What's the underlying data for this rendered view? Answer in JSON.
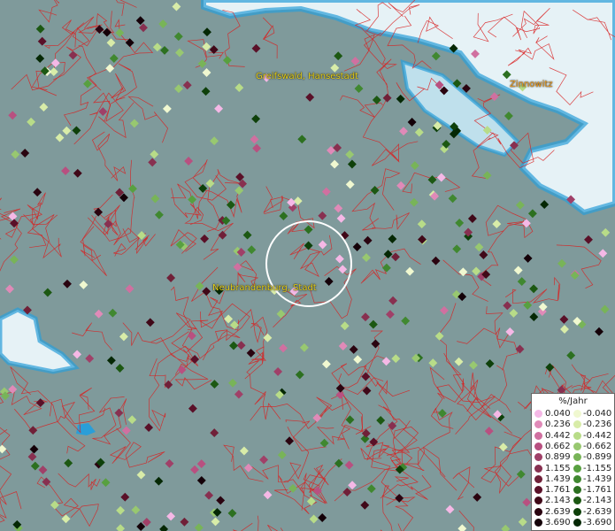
{
  "places": {
    "greifswald": "Greifswald, Hansestadt",
    "zinnowitz": "Zinnowitz",
    "neubrandenburg": "Neubrandenburg, Stadt"
  },
  "legend": {
    "title": "%/Jahr",
    "positive": [
      "0.040",
      "0.236",
      "0.442",
      "0.662",
      "0.899",
      "1.155",
      "1.439",
      "1.761",
      "2.143",
      "2.639",
      "3.690"
    ],
    "negative": [
      "-0.040",
      "-0.236",
      "-0.442",
      "-0.662",
      "-0.899",
      "-1.155",
      "-1.439",
      "-1.761",
      "-2.143",
      "-2.639",
      "-3.690"
    ],
    "positive_colors": [
      "#f5b8e6",
      "#e08ab8",
      "#d070a0",
      "#b85080",
      "#a04068",
      "#883050",
      "#702038",
      "#5a1028",
      "#400818",
      "#2a0410",
      "#140008"
    ],
    "negative_colors": [
      "#f0f8d0",
      "#d8eca8",
      "#b8dc88",
      "#98c870",
      "#78b458",
      "#58a040",
      "#408830",
      "#2c7020",
      "#1c5812",
      "#0e400a",
      "#052804"
    ]
  },
  "colors": {
    "land": "#7f9a9b",
    "water": "#e6f2f6",
    "water_edge": "#2a9ed8",
    "boundary": "#d82020",
    "focus_ring": "#ffffff"
  }
}
